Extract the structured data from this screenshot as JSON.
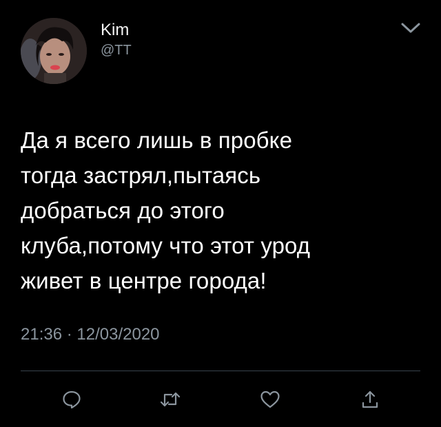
{
  "tweet": {
    "author_name": "Kim",
    "author_handle": "@TT",
    "text_lines": [
      "Да я всего лишь в пробке",
      "тогда застрял,пытаясь",
      "добраться до этого",
      "клуба,потому что этот урод",
      "живет в центре города!"
    ],
    "time": "21:36",
    "separator": "·",
    "date": "12/03/2020"
  },
  "icons": {
    "menu": "chevron-down-icon",
    "reply": "reply-icon",
    "retweet": "retweet-icon",
    "like": "heart-icon",
    "share": "share-icon"
  },
  "colors": {
    "background": "#000000",
    "text": "#ffffff",
    "secondary": "#8b959e",
    "divider": "#38444d"
  }
}
